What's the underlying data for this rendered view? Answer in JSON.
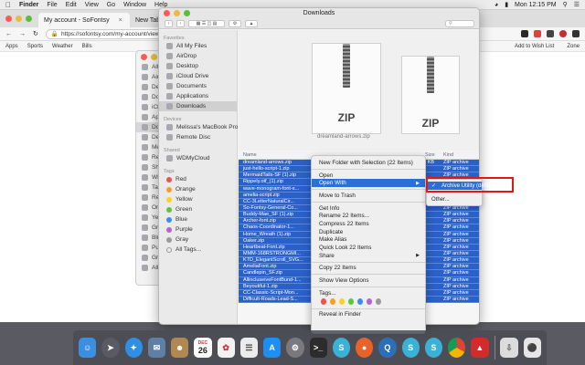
{
  "menubar": {
    "app": "Finder",
    "items": [
      "File",
      "Edit",
      "View",
      "Go",
      "Window",
      "Help"
    ],
    "clock": "Mon 12:15 PM"
  },
  "chrome": {
    "tabs": [
      {
        "label": "My account - SoFontsy"
      },
      {
        "label": "New Tab"
      }
    ],
    "url": "https://sofontsy.com/my-account/view",
    "bookmarks": [
      "Apps",
      "Sports",
      "Weather",
      "Bills"
    ],
    "bookmarks_right": [
      "Add to Wish List",
      "Zone"
    ]
  },
  "bg_finder": {
    "rows": [
      "All",
      "Air",
      "Des",
      "Doc",
      "iClo",
      "App",
      "Dow",
      "Devices",
      "Me",
      "Rer",
      "Shared",
      "WD",
      "Tags",
      "Red",
      "Ora",
      "Yel",
      "Gre",
      "Blu",
      "Pur",
      "Gra",
      "All"
    ]
  },
  "finder": {
    "title": "Downloads",
    "sidebar": {
      "favorites_header": "Favorites",
      "favorites": [
        "All My Files",
        "AirDrop",
        "Desktop",
        "iCloud Drive",
        "Documents",
        "Applications",
        "Downloads"
      ],
      "devices_header": "Devices",
      "devices": [
        "Melissa's MacBook Pro",
        "Remote Disc"
      ],
      "shared_header": "Shared",
      "shared": [
        "WDMyCloud"
      ],
      "tags_header": "Tags",
      "tags": [
        {
          "label": "Red",
          "color": "#f0524a"
        },
        {
          "label": "Orange",
          "color": "#f5a023"
        },
        {
          "label": "Yellow",
          "color": "#f5d327"
        },
        {
          "label": "Green",
          "color": "#5cc53c"
        },
        {
          "label": "Blue",
          "color": "#3b8cf2"
        },
        {
          "label": "Purple",
          "color": "#b462d6"
        },
        {
          "label": "Gray",
          "color": "#9a9a9a"
        },
        {
          "label": "All Tags..."
        }
      ]
    },
    "preview": {
      "zip_label": "ZIP",
      "caption": "dreamland-arrows.zip"
    },
    "list_header": {
      "name": "Name",
      "size": "Size",
      "kind": "Kind"
    },
    "files": [
      {
        "name": "dreamland-arrows.zip",
        "size": "626 KB",
        "kind": "ZIP archive"
      },
      {
        "name": "just-hello-script-1.zip",
        "size": "MB",
        "kind": "ZIP archive"
      },
      {
        "name": "MermaidTails-SF (1).zip",
        "size": "MB",
        "kind": "ZIP archive"
      },
      {
        "name": "Rippely.otf_(1).zip",
        "size": "MB",
        "kind": "ZIP archive"
      },
      {
        "name": "wave-monogram-font-s...",
        "size": "MB",
        "kind": "ZIP archive"
      },
      {
        "name": "amelia-script.zip",
        "size": "MB",
        "kind": "ZIP archive"
      },
      {
        "name": "CC-3LetterNaturalCir...",
        "size": "MB",
        "kind": "ZIP archive"
      },
      {
        "name": "So-Fontsy-General-Co...",
        "size": "MB",
        "kind": "ZIP archive"
      },
      {
        "name": "Buddy-Mae_SF (1).zip",
        "size": "MB",
        "kind": "ZIP archive"
      },
      {
        "name": "Archer-font.zip",
        "size": "MB",
        "kind": "ZIP archive"
      },
      {
        "name": "Chaos-Coordinator-1...",
        "size": "MB",
        "kind": "ZIP archive"
      },
      {
        "name": "Home_Wreath (1).zip",
        "size": "MB",
        "kind": "ZIP archive"
      },
      {
        "name": "Oaker.zip",
        "size": "MB",
        "kind": "ZIP archive"
      },
      {
        "name": "Heartbeat-Font.zip",
        "size": "MB",
        "kind": "ZIP archive"
      },
      {
        "name": "MMM-168RSTRONGMI...",
        "size": "MB",
        "kind": "ZIP archive"
      },
      {
        "name": "KTD_ElegantScroll_SVG...",
        "size": "MB",
        "kind": "ZIP archive"
      },
      {
        "name": "AmeliaFont.zip",
        "size": "MB",
        "kind": "ZIP archive"
      },
      {
        "name": "Candlepin_SF.zip",
        "size": "MB",
        "kind": "ZIP archive"
      },
      {
        "name": "AllincluseiveFontBund-1...",
        "size": "MB",
        "kind": "ZIP archive"
      },
      {
        "name": "Beyoutiful-1.zip",
        "size": "MB",
        "kind": "ZIP archive"
      },
      {
        "name": "CC-Classic-Script-Mon...",
        "size": "MB",
        "kind": "ZIP archive"
      },
      {
        "name": "Difficult-Roads-Lead-S...",
        "size": "MB",
        "kind": "ZIP archive"
      }
    ]
  },
  "context_menu": {
    "items": [
      {
        "label": "New Folder with Selection (22 Items)"
      },
      {
        "sep": true
      },
      {
        "label": "Open"
      },
      {
        "label": "Open With",
        "highlight": true,
        "submenu": true
      },
      {
        "sep": true
      },
      {
        "label": "Move to Trash"
      },
      {
        "sep": true
      },
      {
        "label": "Get Info"
      },
      {
        "label": "Rename 22 Items..."
      },
      {
        "label": "Compress 22 Items"
      },
      {
        "label": "Duplicate"
      },
      {
        "label": "Make Alias"
      },
      {
        "label": "Quick Look 22 Items"
      },
      {
        "label": "Share",
        "submenu": true
      },
      {
        "sep": true
      },
      {
        "label": "Copy 22 Items"
      },
      {
        "sep": true
      },
      {
        "label": "Show View Options"
      },
      {
        "sep": true
      },
      {
        "label": "Tags..."
      },
      {
        "tags": true
      },
      {
        "sep": true
      },
      {
        "label": "Reveal in Finder"
      }
    ],
    "tag_colors": [
      "#f0524a",
      "#f5a023",
      "#f5d327",
      "#5cc53c",
      "#3b8cf2",
      "#b462d6",
      "#9a9a9a"
    ]
  },
  "open_with_submenu": {
    "default_app": "Archive Utility (default)",
    "other": "Other..."
  },
  "dock": {
    "calendar_month": "DEC",
    "calendar_day": "26"
  }
}
